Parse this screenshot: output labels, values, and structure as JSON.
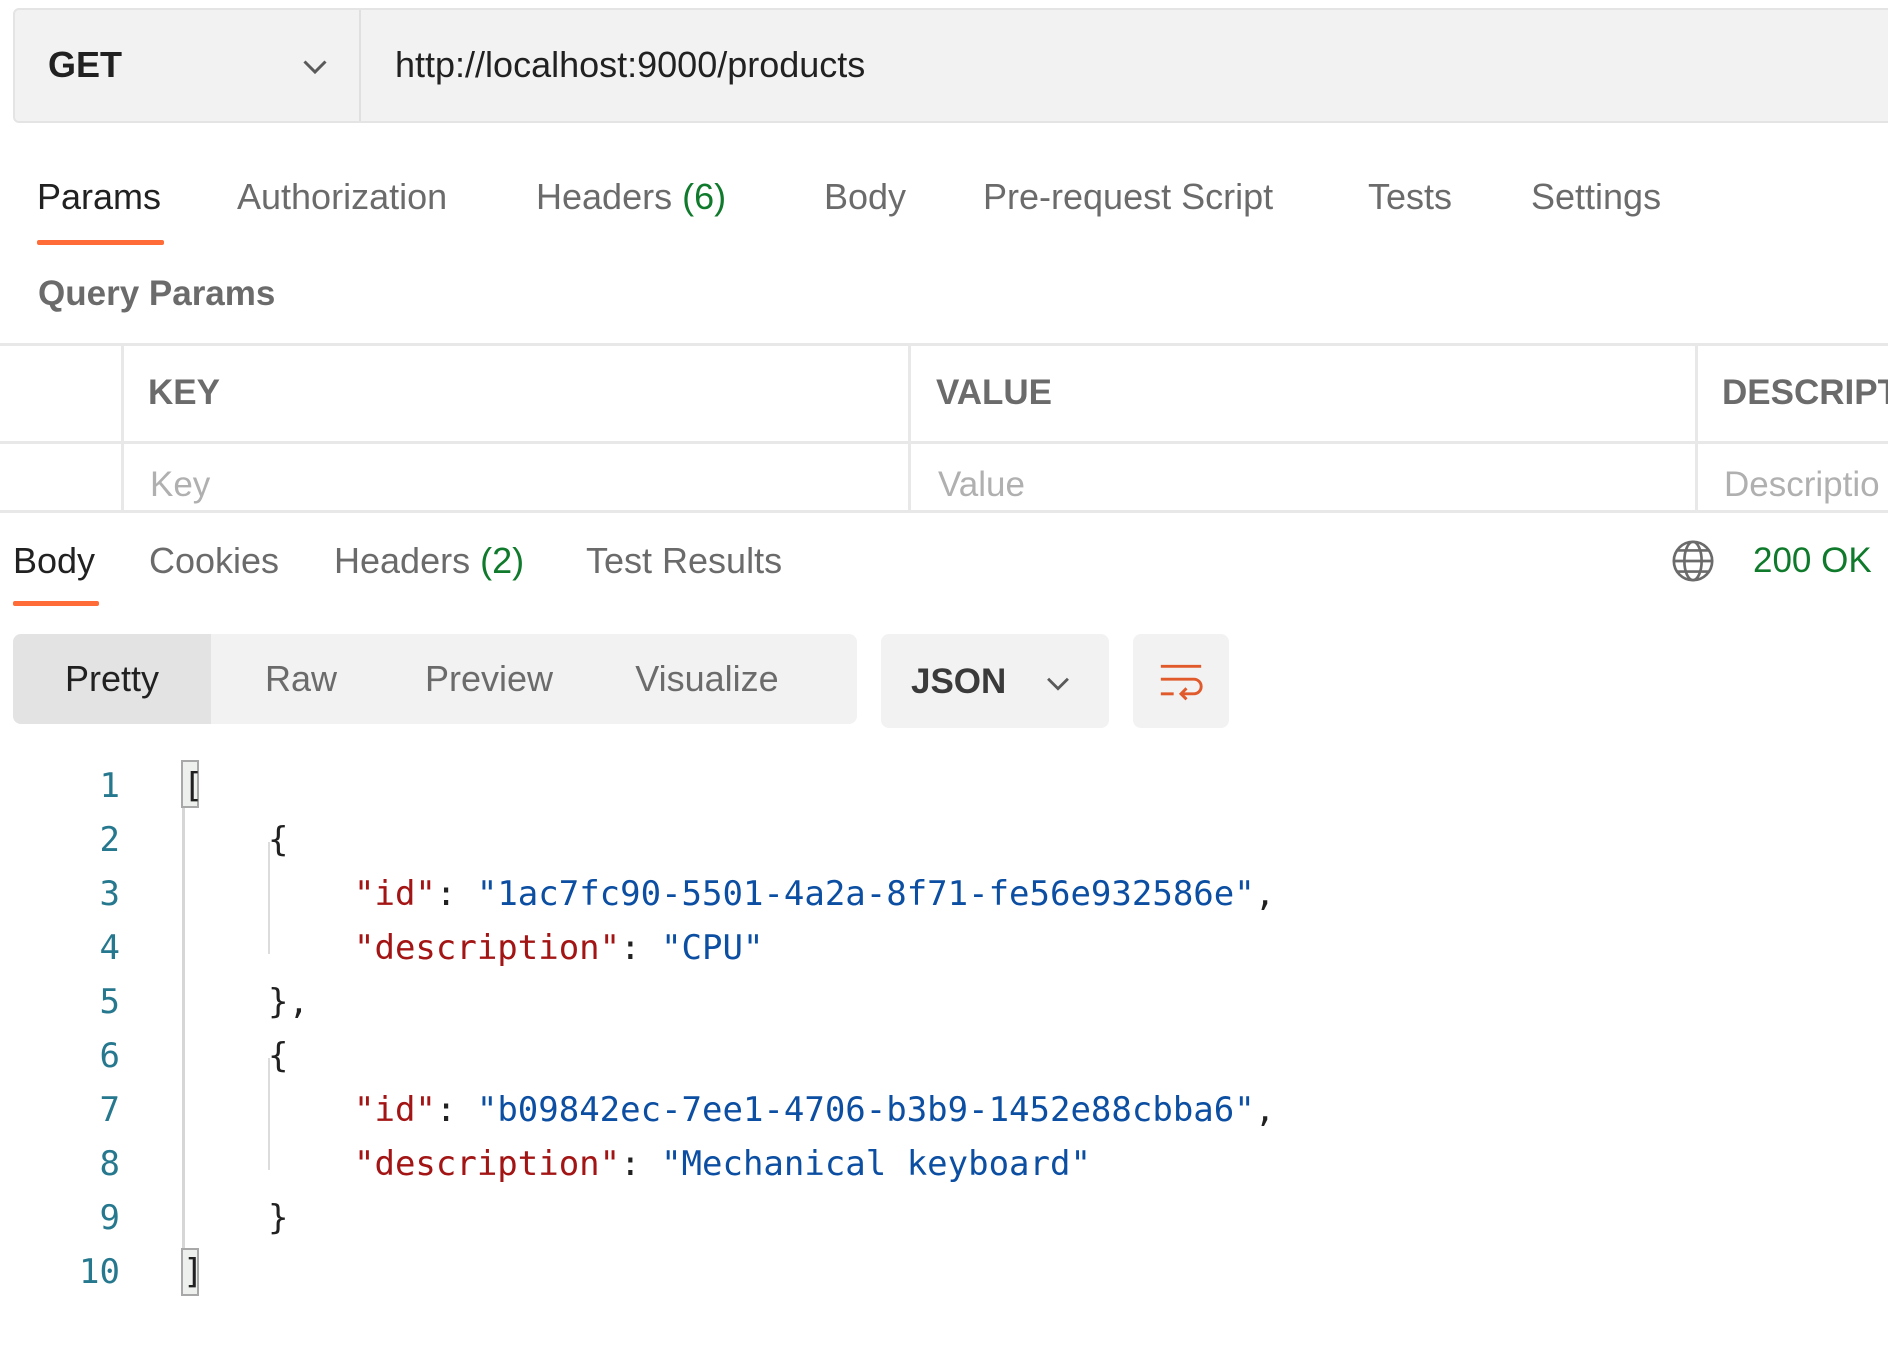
{
  "request": {
    "method": "GET",
    "url": "http://localhost:9000/products"
  },
  "request_tabs": {
    "params": "Params",
    "authorization": "Authorization",
    "headers": "Headers",
    "headers_count": "(6)",
    "body": "Body",
    "pre_request": "Pre-request Script",
    "tests": "Tests",
    "settings": "Settings"
  },
  "query_params": {
    "title": "Query Params",
    "columns": {
      "key": "KEY",
      "value": "VALUE",
      "description": "DESCRIPT"
    },
    "placeholders": {
      "key": "Key",
      "value": "Value",
      "description": "Descriptio"
    }
  },
  "response_tabs": {
    "body": "Body",
    "cookies": "Cookies",
    "headers": "Headers",
    "headers_count": "(2)",
    "test_results": "Test Results"
  },
  "status": {
    "text": "200 OK",
    "color": "#0f7a2b"
  },
  "view_modes": {
    "pretty": "Pretty",
    "raw": "Raw",
    "preview": "Preview",
    "visualize": "Visualize"
  },
  "format": {
    "selected": "JSON"
  },
  "icons": {
    "method_chevron": "chevron-down-icon",
    "globe": "globe-icon",
    "format_chevron": "chevron-down-icon",
    "wrap": "wrap-lines-icon"
  },
  "colors": {
    "accent": "#ff6c37",
    "count": "#0f7a2b",
    "json_key": "#a31515",
    "json_string": "#0b4ea2",
    "line_number": "#26788e"
  },
  "code": {
    "line_numbers": [
      "1",
      "2",
      "3",
      "4",
      "5",
      "6",
      "7",
      "8",
      "9",
      "10"
    ],
    "open_array": "[",
    "open_obj": "{",
    "close_obj_comma": "},",
    "close_obj": "}",
    "close_array": "]",
    "colon": ": ",
    "comma": ",",
    "items": [
      {
        "id_key": "\"id\"",
        "id_value": "\"1ac7fc90-5501-4a2a-8f71-fe56e932586e\"",
        "desc_key": "\"description\"",
        "desc_value": "\"CPU\""
      },
      {
        "id_key": "\"id\"",
        "id_value": "\"b09842ec-7ee1-4706-b3b9-1452e88cbba6\"",
        "desc_key": "\"description\"",
        "desc_value": "\"Mechanical keyboard\""
      }
    ]
  }
}
